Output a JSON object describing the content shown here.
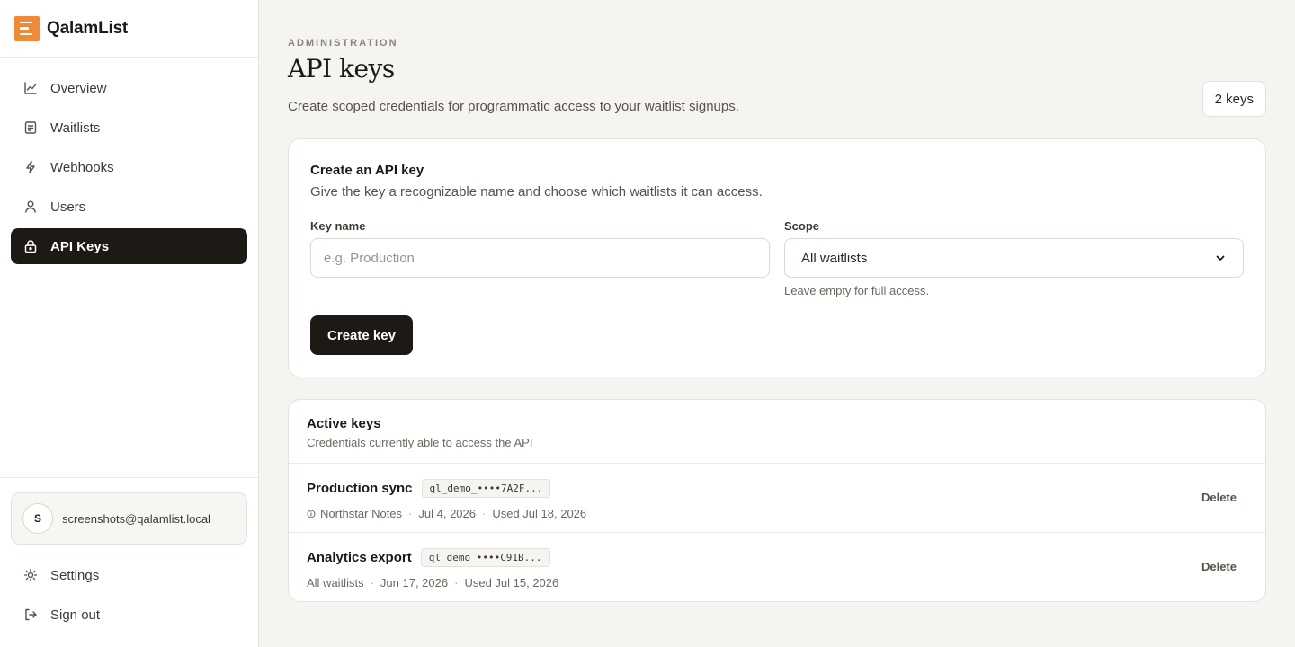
{
  "brand": {
    "name": "QalamList"
  },
  "sidebar": {
    "items": [
      {
        "label": "Overview",
        "icon": "chart-line-icon"
      },
      {
        "label": "Waitlists",
        "icon": "list-icon"
      },
      {
        "label": "Webhooks",
        "icon": "bolt-icon"
      },
      {
        "label": "Users",
        "icon": "user-icon"
      },
      {
        "label": "API Keys",
        "icon": "lock-icon",
        "active": true
      }
    ],
    "user": {
      "initial": "S",
      "email": "screenshots@qalamlist.local"
    },
    "settings_label": "Settings",
    "signout_label": "Sign out"
  },
  "header": {
    "eyebrow": "ADMINISTRATION",
    "title": "API keys",
    "description": "Create scoped credentials for programmatic access to your waitlist signups.",
    "count": "2 keys"
  },
  "create": {
    "title": "Create an API key",
    "description": "Give the key a recognizable name and choose which waitlists it can access.",
    "name_label": "Key name",
    "name_placeholder": "e.g. Production",
    "name_value": "",
    "scope_label": "Scope",
    "scope_value": "All waitlists",
    "scope_hint": "Leave empty for full access.",
    "button_label": "Create key"
  },
  "keys": {
    "title": "Active keys",
    "subtitle": "Credentials currently able to access the API",
    "delete_label": "Delete",
    "rows": [
      {
        "name": "Production sync",
        "token": "ql_demo_••••7A2F...",
        "scope": "Northstar Notes",
        "scoped": true,
        "created": "Jul 4, 2026",
        "used": "Used Jul 18, 2026"
      },
      {
        "name": "Analytics export",
        "token": "ql_demo_••••C91B...",
        "scope": "All waitlists",
        "scoped": false,
        "created": "Jun 17, 2026",
        "used": "Used Jul 15, 2026"
      }
    ]
  },
  "colors": {
    "accent": "#ee8a3a",
    "active_nav": "#1d1a16",
    "background": "#f5f4f1"
  }
}
